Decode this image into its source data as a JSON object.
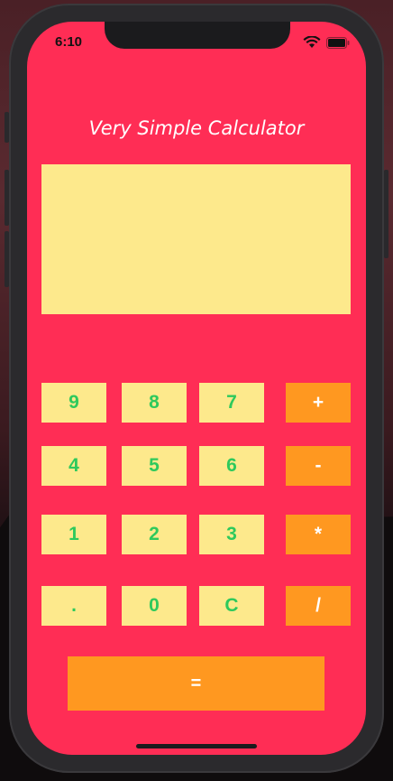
{
  "status_bar": {
    "time": "6:10"
  },
  "app": {
    "title": "Very Simple Calculator",
    "display_value": ""
  },
  "keys": {
    "k9": "9",
    "k8": "8",
    "k7": "7",
    "plus": "+",
    "k4": "4",
    "k5": "5",
    "k6": "6",
    "minus": "-",
    "k1": "1",
    "k2": "2",
    "k3": "3",
    "multiply": "*",
    "dot": ".",
    "k0": "0",
    "clear": "C",
    "divide": "/",
    "equals": "="
  },
  "colors": {
    "background": "#ff2d55",
    "display": "#fde98c",
    "number_key": "#fde98c",
    "number_text": "#2ec95c",
    "operator_key": "#ff9820",
    "operator_text": "#ffffff"
  }
}
